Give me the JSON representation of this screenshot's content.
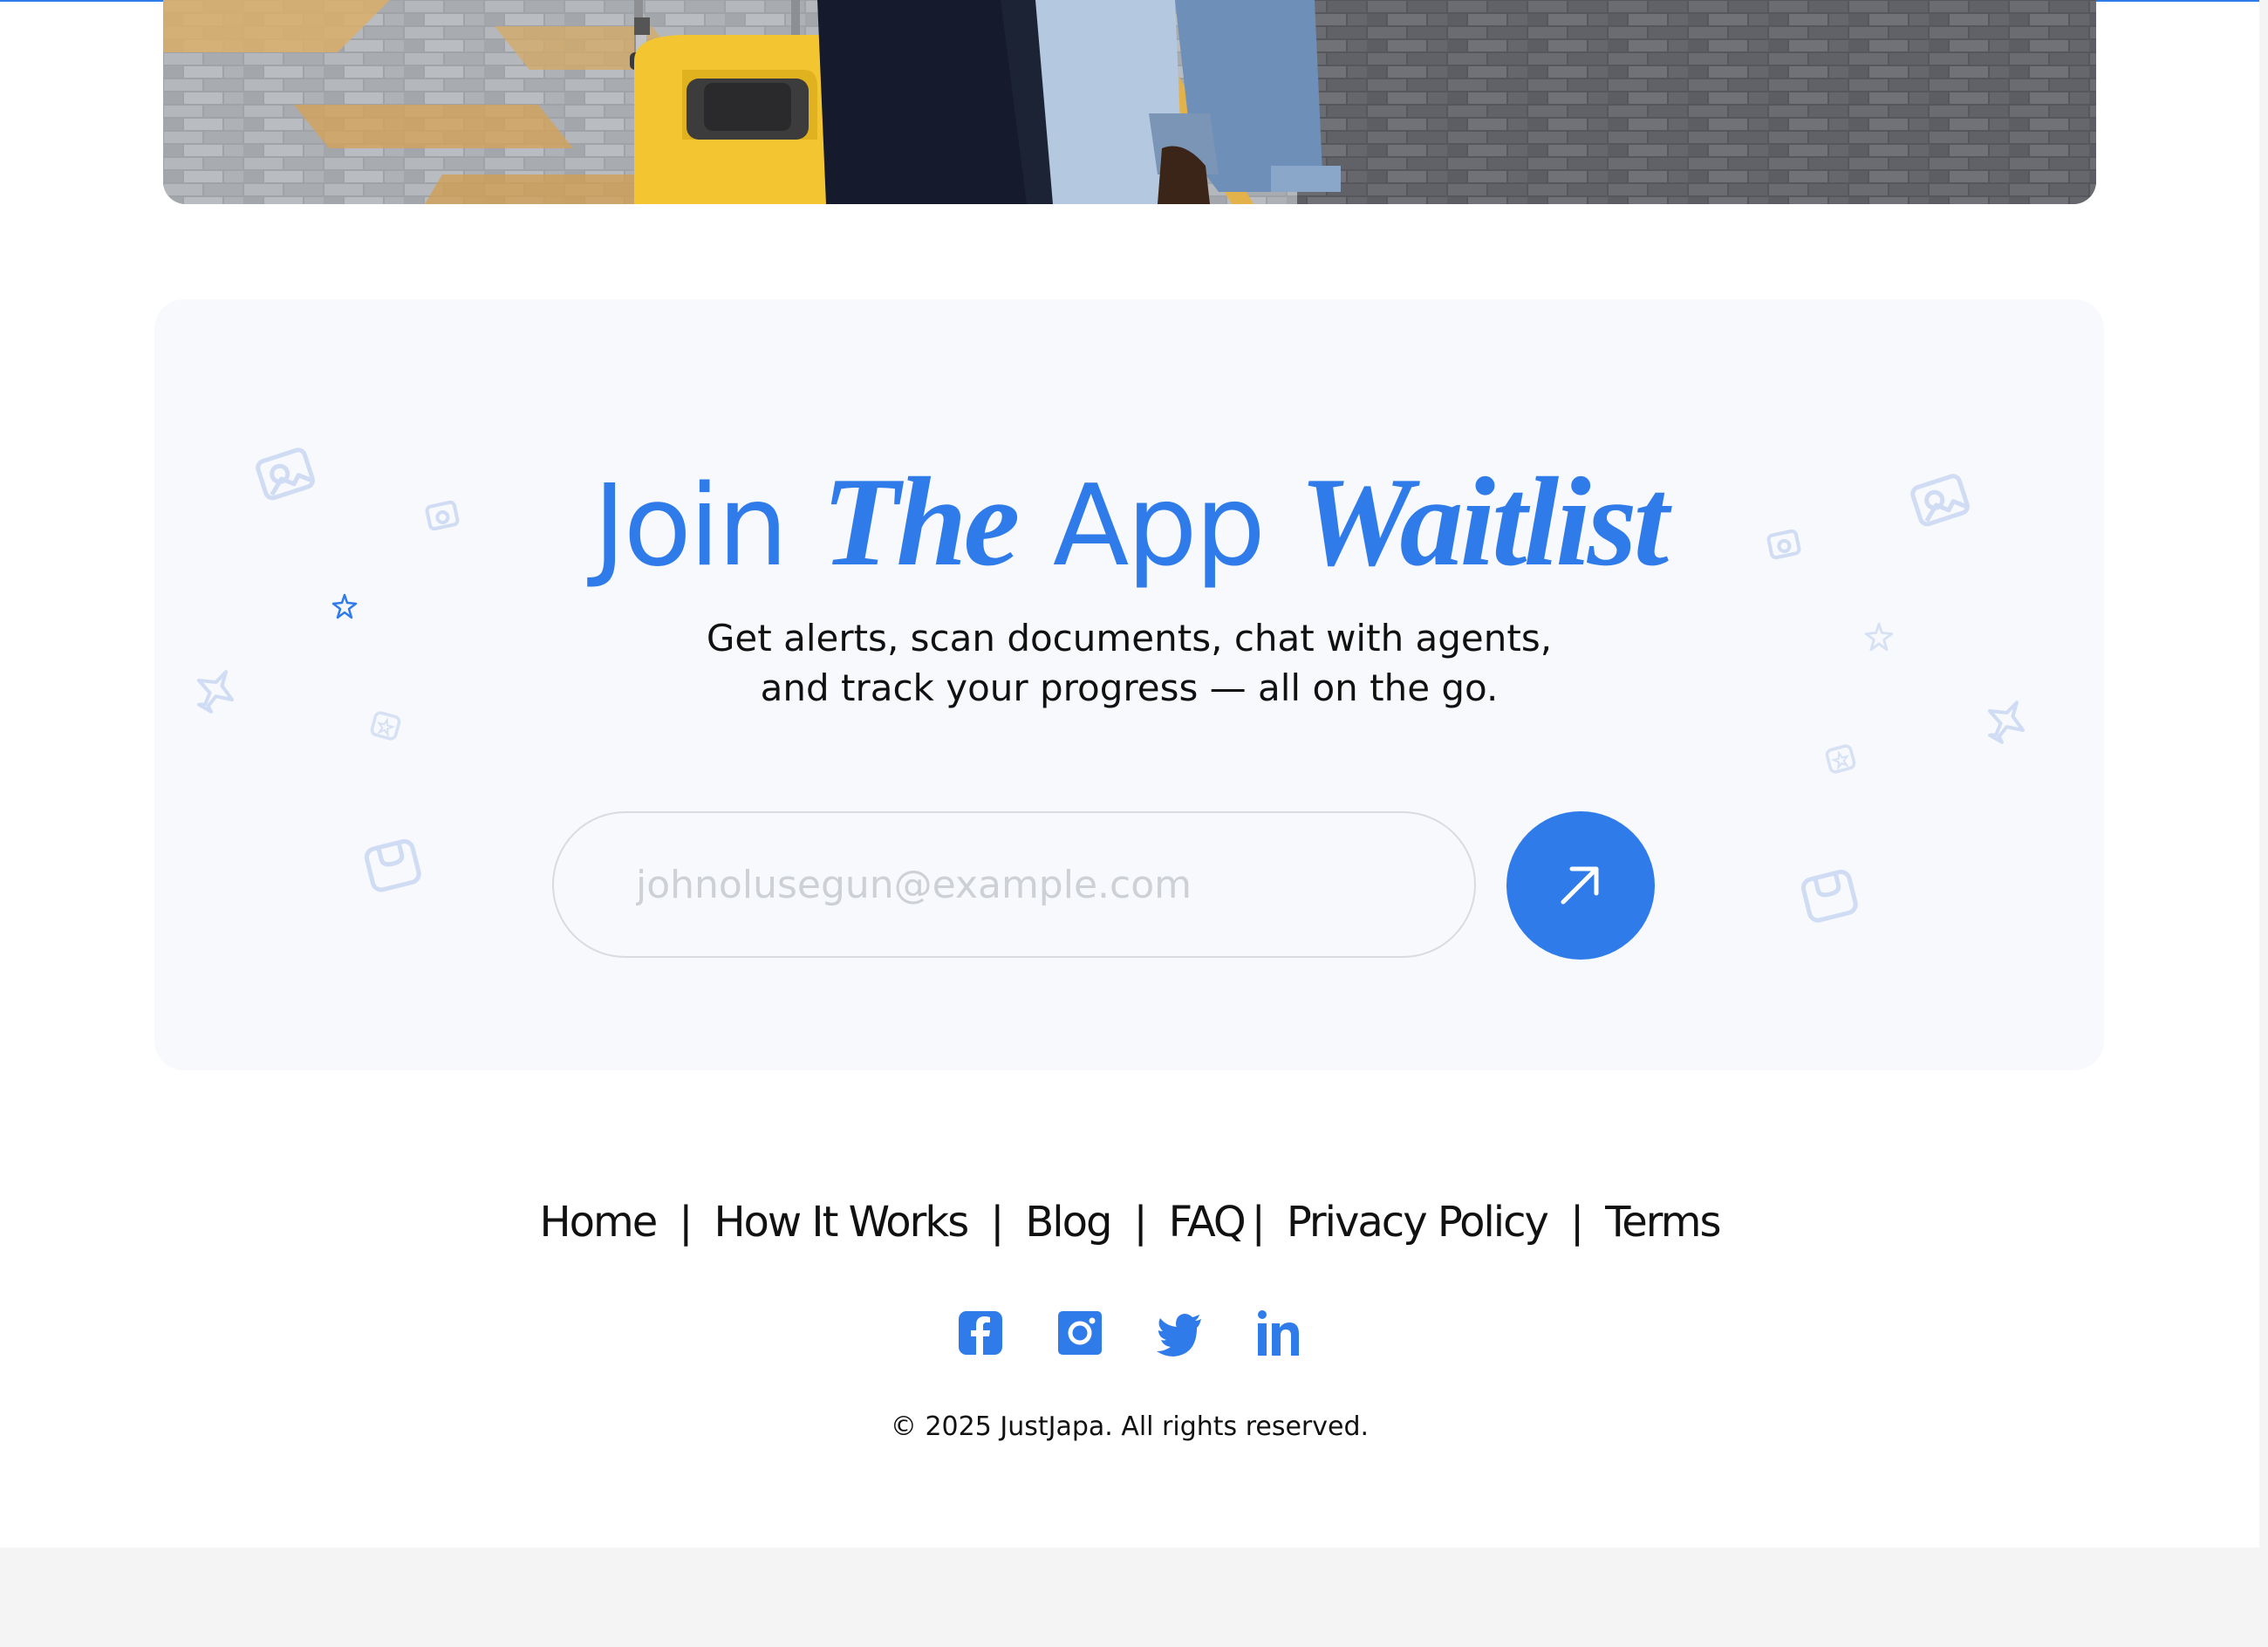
{
  "colors": {
    "accent": "#2f7bea",
    "card_bg": "#f7f9fc",
    "text": "#111111",
    "page_bg": "#f4f4f4"
  },
  "hero": {
    "image_alt": "Travelers walking with luggage on a paved walkway"
  },
  "waitlist": {
    "title_parts": [
      "Join",
      "The",
      "App",
      "Waitlist"
    ],
    "subtitle_lines": [
      "Get alerts, scan documents, chat with agents,",
      "and track your progress — all on the go."
    ],
    "email_placeholder": "johnolusegun@example.com",
    "submit_icon": "arrow-up-right-icon",
    "decor_icons": [
      "travel-photo-icon",
      "airplane-icon",
      "luggage-icon",
      "star-icon"
    ]
  },
  "footer": {
    "nav": [
      "Home",
      "How It Works",
      "Blog",
      "FAQ",
      "Privacy Policy",
      "Terms"
    ],
    "separator": "|",
    "social": [
      "facebook-icon",
      "instagram-icon",
      "twitter-icon",
      "linkedin-icon"
    ],
    "copyright": "© 2025 JustJapa. All rights reserved."
  }
}
